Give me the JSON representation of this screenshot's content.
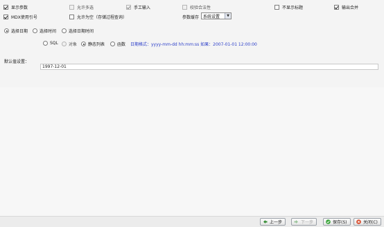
{
  "row1": [
    {
      "label": "显示参数",
      "checked": true,
      "disabled": false
    },
    {
      "label": "允许多选",
      "checked": false,
      "disabled": true
    },
    {
      "label": "手工输入",
      "checked": true,
      "disabled": true
    },
    {
      "label": "校验合法性",
      "checked": false,
      "disabled": true
    },
    {
      "label": "不显示标题",
      "checked": false,
      "disabled": false
    },
    {
      "label": "输出合并",
      "checked": true,
      "disabled": false
    }
  ],
  "row2": {
    "mdx_label": "MDX使用引号",
    "allow_empty_label": "允许为空（存储过程查询）",
    "param_cache_label": "参数缓存",
    "param_cache_value": "系统设置"
  },
  "type_radios": [
    "选择日期",
    "选择时间",
    "选择日期时间"
  ],
  "source_radios": [
    "SQL",
    "对象",
    "静态列表",
    "函数"
  ],
  "date_format_hint": "日期格式：yyyy-mm-dd hh:mm:ss 如果：2007-01-01 12:00:00",
  "default_label": "默认值设置：",
  "default_value": "1997-12-01",
  "footer": {
    "prev": "上一步",
    "next": "下一步",
    "save": "保存(S)",
    "close": "关闭(C)"
  },
  "colors": {
    "hint": "#2b3ec9",
    "save_icon": "#3aa53a",
    "close_icon": "#d84a2a"
  }
}
